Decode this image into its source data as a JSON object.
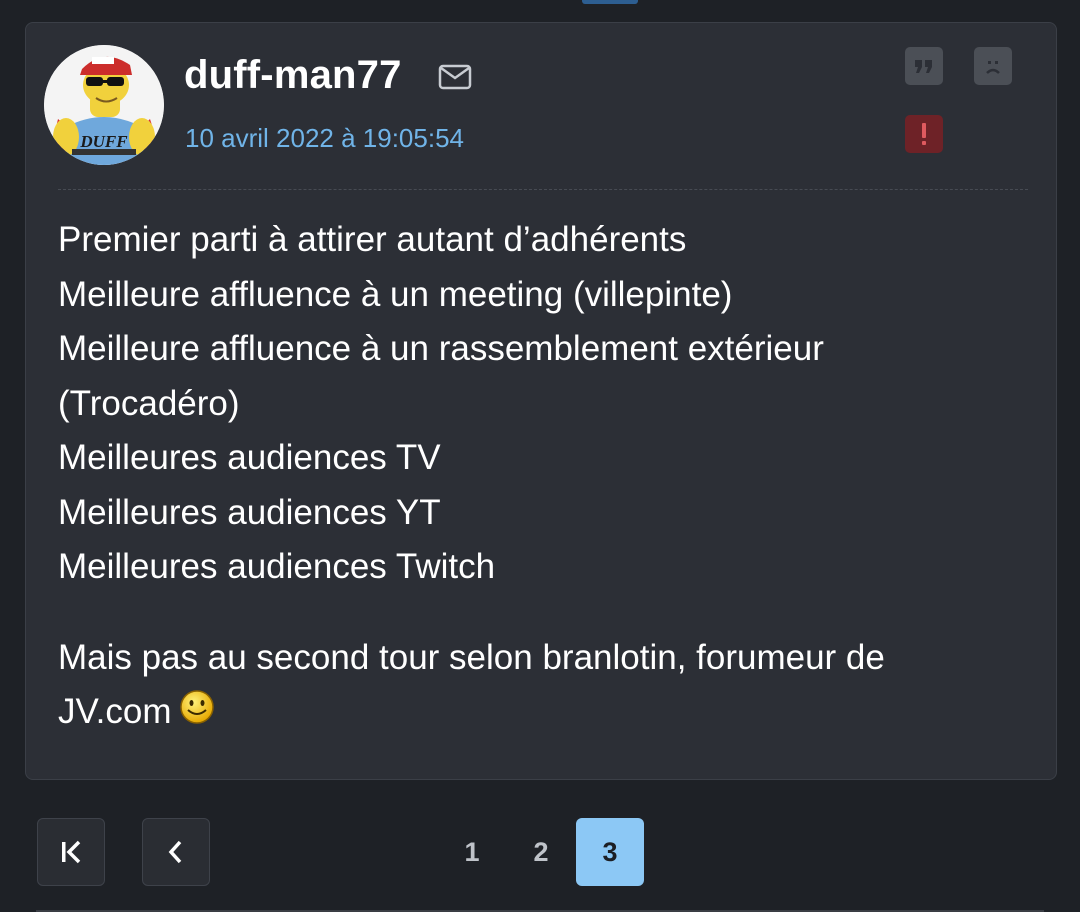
{
  "post": {
    "author": "duff-man77",
    "date": "10 avril 2022 à 19:05:54",
    "body_lines": [
      "Premier parti à attirer autant d’adhérents",
      "Meilleure affluence à un meeting (villepinte)",
      "Meilleure affluence à un rassemblement extérieur",
      "(Trocadéro)",
      "Meilleures audiences TV",
      "Meilleures audiences YT",
      "Meilleures audiences Twitch"
    ],
    "closing_lines": [
      "Mais pas au second tour selon branlotin, forumeur de",
      "JV.com"
    ],
    "avatar_text": "DUFF",
    "icons": {
      "message": "mail-icon",
      "quote": "quote-icon",
      "private_message": "sad-face-icon",
      "report": "exclamation-icon",
      "emoji": "smiley-icon"
    }
  },
  "pagination": {
    "pages": [
      "1",
      "2",
      "3"
    ],
    "current": "3",
    "first_icon": "first-page-icon",
    "prev_icon": "chevron-left-icon"
  },
  "colors": {
    "background": "#1e2126",
    "card": "#2c2f36",
    "date": "#70b4e8",
    "action_button": "#4b4f56",
    "report_button": "#6e2227",
    "active_page": "#8cc8f5"
  }
}
